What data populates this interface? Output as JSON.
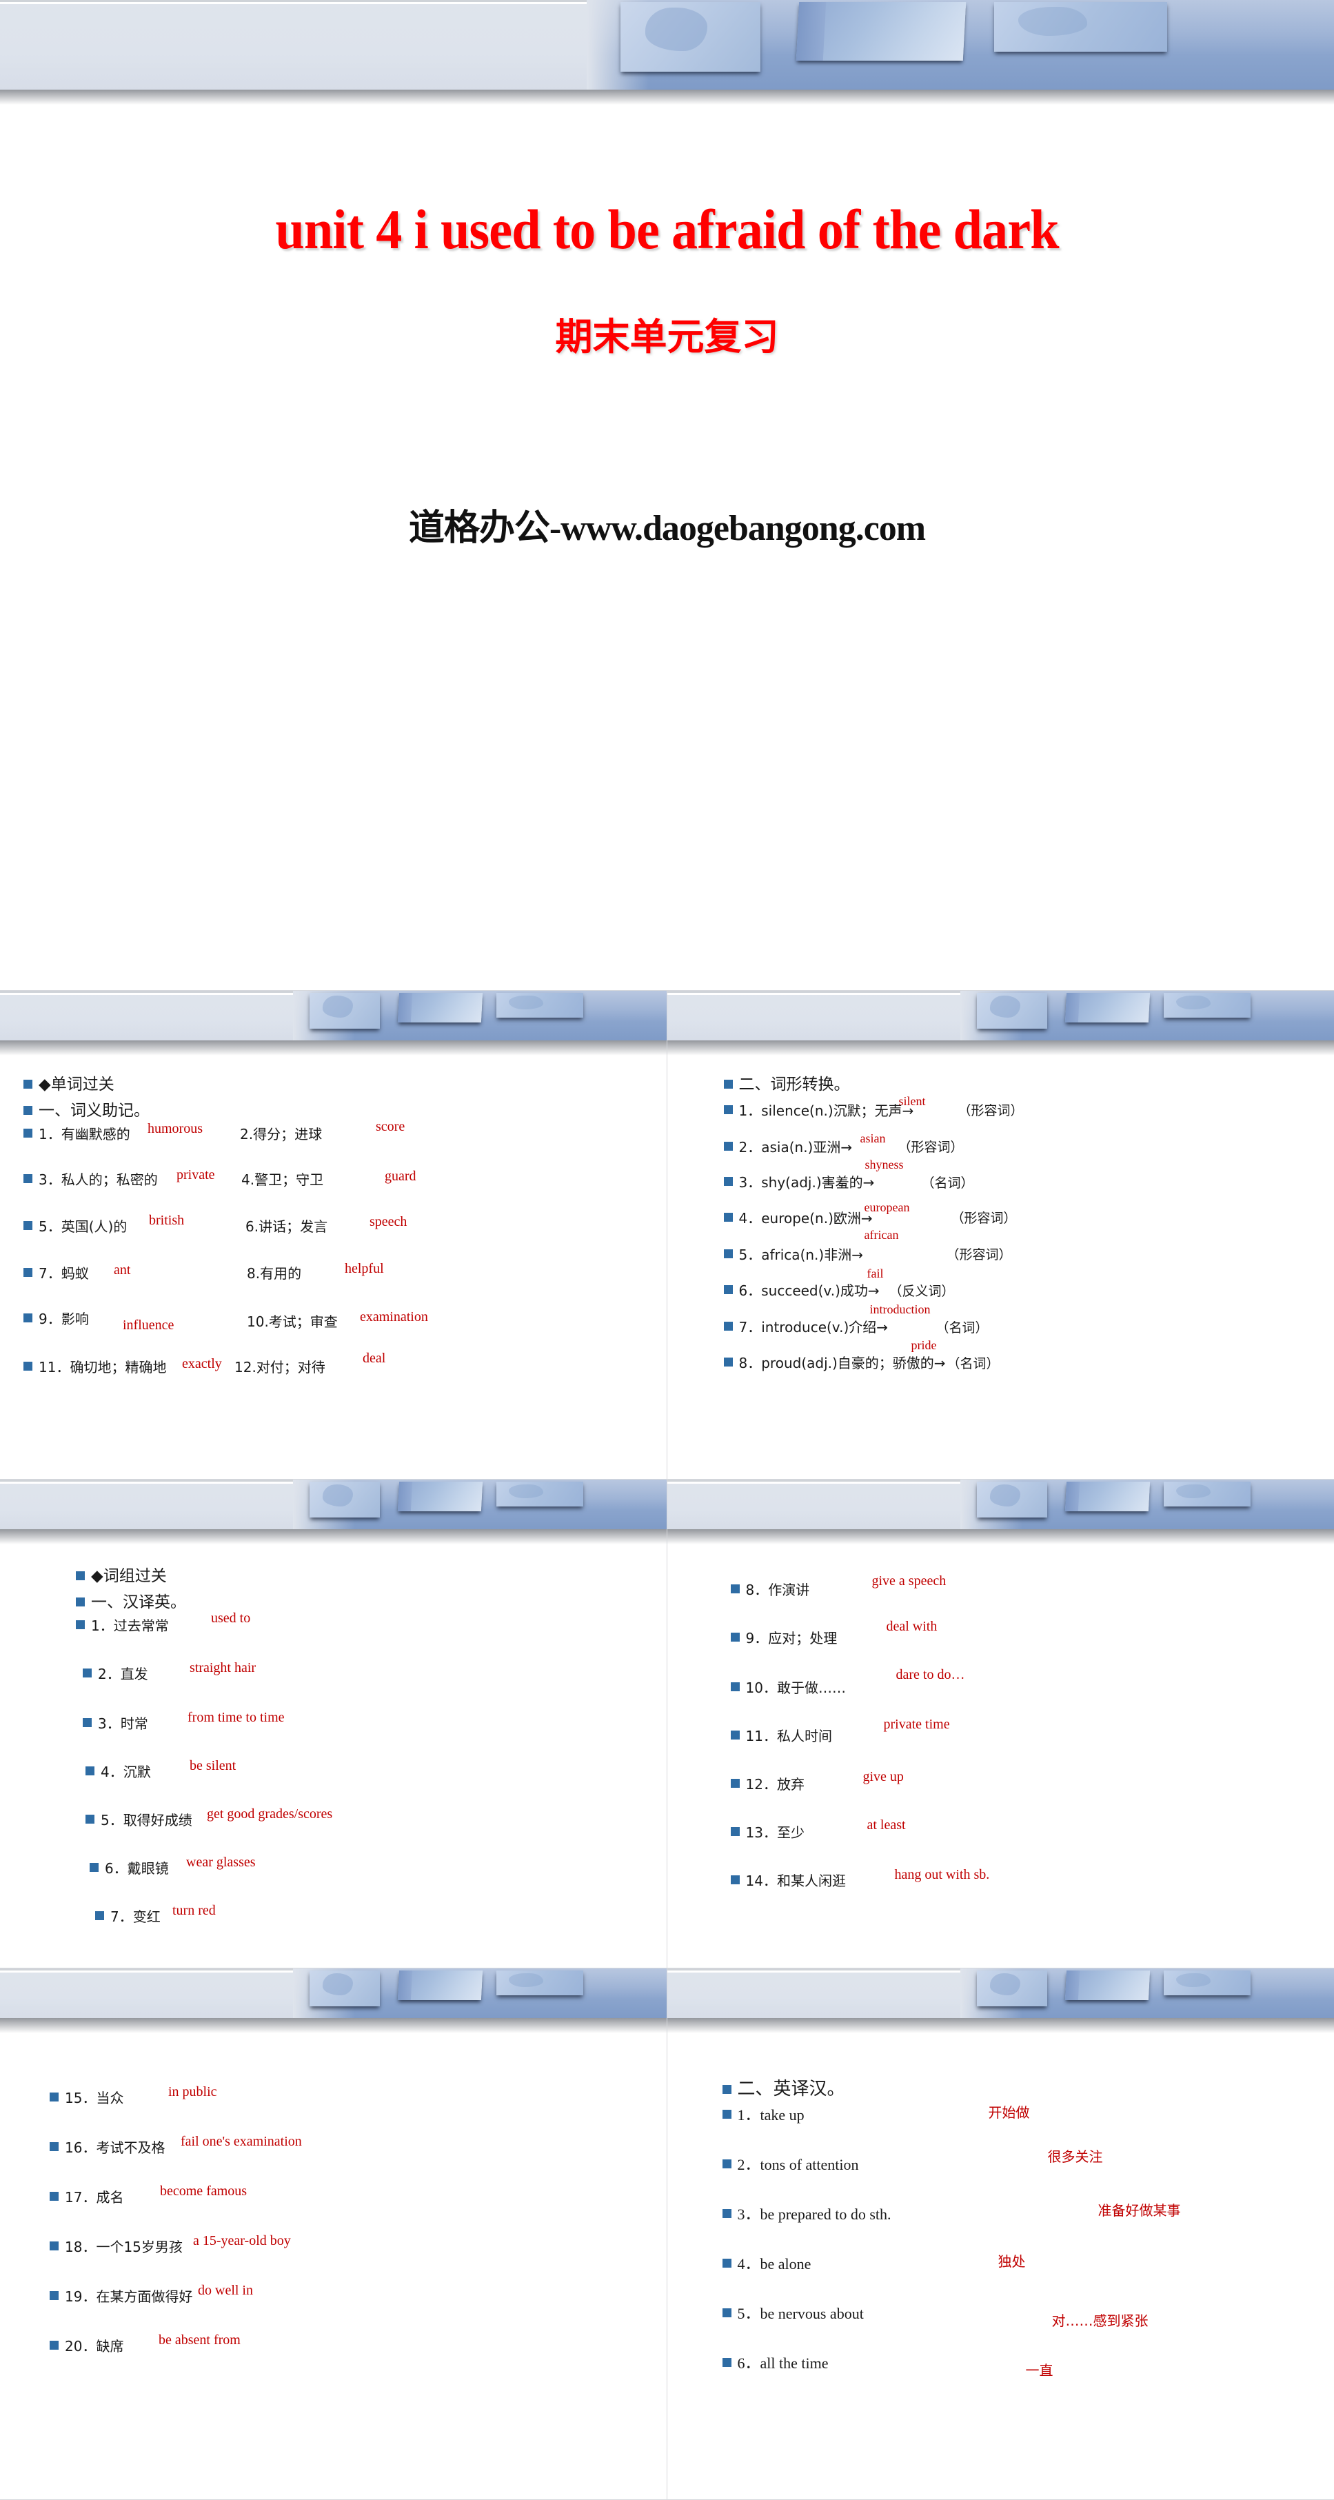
{
  "deck": {
    "title_slide": {
      "main_title": "unit 4  i used to be afraid of the dark",
      "sub_title": "期末单元复习",
      "watermark": "道格办公-www.daogebangong.com",
      "title_color": "#ff0000",
      "watermark_color": "#111111"
    },
    "theme": {
      "bullet_color": "#2e6ca4",
      "answer_color": "#c00000",
      "text_color": "#1a1a1a",
      "banner_blue": "#8aa4cd",
      "banner_gray": "#dfe4ec"
    },
    "slide2": {
      "heading1": "◆单词过关",
      "heading2": "一、词义助记。",
      "rows": [
        {
          "left_num": "1．",
          "left_cn": "有幽默感的",
          "left_ans": "humorous",
          "right_num": "2.",
          "right_cn": "得分；进球",
          "right_ans": "score"
        },
        {
          "left_num": "3．",
          "left_cn": "私人的；私密的",
          "left_ans": "private",
          "right_num": "4.",
          "right_cn": "警卫；守卫",
          "right_ans": "guard"
        },
        {
          "left_num": "5．",
          "left_cn": "英国(人)的",
          "left_ans": "british",
          "right_num": "6.",
          "right_cn": "讲话；发言",
          "right_ans": "speech"
        },
        {
          "left_num": "7．",
          "left_cn": "蚂蚁",
          "left_ans": "ant",
          "right_num": "8.",
          "right_cn": "有用的",
          "right_ans": "helpful"
        },
        {
          "left_num": "9．",
          "left_cn": "影响",
          "left_ans": "influence",
          "right_num": "10.",
          "right_cn": "考试；审查",
          "right_ans": "examination"
        },
        {
          "left_num": "11．",
          "left_cn": "确切地；精确地",
          "left_ans": "exactly",
          "right_num": "12.",
          "right_cn": "对付；对待",
          "right_ans": "deal"
        }
      ]
    },
    "slide3": {
      "heading": "二、词形转换。",
      "rows": [
        {
          "num": "1．",
          "prompt": "silence(n.)沉默；无声→",
          "ans": "silent",
          "pos": "（形容词）"
        },
        {
          "num": "2．",
          "prompt": "asia(n.)亚洲→",
          "ans": "asian",
          "pos": "（形容词）"
        },
        {
          "num": "3．",
          "prompt": "shy(adj.)害羞的→",
          "ans": "shyness",
          "pos": "（名词）"
        },
        {
          "num": "4．",
          "prompt": "europe(n.)欧洲→",
          "ans": "european",
          "pos": "（形容词）"
        },
        {
          "num": "5．",
          "prompt": "africa(n.)非洲→",
          "ans": "african",
          "pos": "（形容词）"
        },
        {
          "num": "6．",
          "prompt": "succeed(v.)成功→",
          "ans": "fail",
          "pos": "（反义词）"
        },
        {
          "num": "7．",
          "prompt": "introduce(v.)介绍→",
          "ans": "introduction",
          "pos": "（名词）"
        },
        {
          "num": "8．",
          "prompt": "proud(adj.)自豪的；骄傲的→",
          "ans": "pride",
          "pos": "（名词）"
        }
      ]
    },
    "slide4": {
      "heading1": "◆词组过关",
      "heading2": "一、汉译英。",
      "rows": [
        {
          "num": "1．",
          "cn": "过去常常",
          "ans": "used to"
        },
        {
          "num": "2．",
          "cn": "直发",
          "ans": "straight hair"
        },
        {
          "num": "3．",
          "cn": "时常",
          "ans": "from time to time"
        },
        {
          "num": "4．",
          "cn": "沉默",
          "ans": "be silent"
        },
        {
          "num": "5．",
          "cn": "取得好成绩",
          "ans": "get good grades/scores"
        },
        {
          "num": "6．",
          "cn": "戴眼镜",
          "ans": "wear glasses"
        },
        {
          "num": "7．",
          "cn": "变红",
          "ans": "turn red"
        }
      ]
    },
    "slide5": {
      "rows": [
        {
          "num": "8．",
          "cn": "作演讲",
          "ans": "give a speech"
        },
        {
          "num": "9．",
          "cn": "应对；处理",
          "ans": "deal with"
        },
        {
          "num": "10．",
          "cn": "敢于做……",
          "ans": "dare to do…"
        },
        {
          "num": "11．",
          "cn": "私人时间",
          "ans": "private time"
        },
        {
          "num": "12．",
          "cn": "放弃",
          "ans": "give up"
        },
        {
          "num": "13．",
          "cn": "至少",
          "ans": "at least"
        },
        {
          "num": "14．",
          "cn": "和某人闲逛",
          "ans": "hang out with sb."
        }
      ]
    },
    "slide6": {
      "rows": [
        {
          "num": "15．",
          "cn": "当众",
          "ans": "in public"
        },
        {
          "num": "16．",
          "cn": "考试不及格",
          "ans": "fail one's examination"
        },
        {
          "num": "17．",
          "cn": "成名",
          "ans": "become famous"
        },
        {
          "num": "18．",
          "cn": "一个15岁男孩",
          "ans": "a 15-year-old boy"
        },
        {
          "num": "19．",
          "cn": "在某方面做得好",
          "ans": "do well in"
        },
        {
          "num": "20．",
          "cn": "缺席",
          "ans": "be absent from"
        }
      ]
    },
    "slide7": {
      "heading": "二、英译汉。",
      "rows": [
        {
          "num": "1．",
          "en": "take up",
          "ans": "开始做"
        },
        {
          "num": "2．",
          "en": "tons of attention",
          "ans": "很多关注"
        },
        {
          "num": "3．",
          "en": "be prepared to do sth.",
          "ans": "准备好做某事"
        },
        {
          "num": "4．",
          "en": "be alone",
          "ans": "独处"
        },
        {
          "num": "5．",
          "en": "be nervous about",
          "ans": "对……感到紧张"
        },
        {
          "num": "6．",
          "en": "all the time",
          "ans": "一直"
        }
      ]
    }
  }
}
